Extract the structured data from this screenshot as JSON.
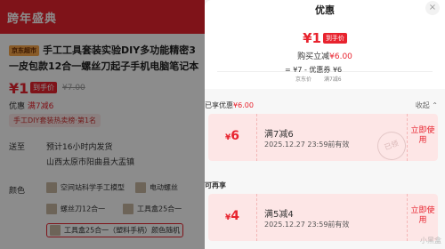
{
  "background": {
    "banner_title": "跨年盛典",
    "product_tag": "京东超市",
    "product_title_line1": "手工工具套装实验DIY多功能精密3",
    "product_title_line2": "一皮包款12合一螺丝刀起子手机电脑笔记本",
    "price_symbol": "¥",
    "price": "1",
    "price_badge": "到手价",
    "price_old": "¥7.00",
    "row_coupon_label": "优惠",
    "row_coupon_value": "满7减6",
    "rank_pill": "手工DIY套装热卖榜·第1名",
    "delivery_label": "送至",
    "delivery_text": "预计16小时内发货",
    "address_text": "山西太原市阳曲县大盂镇",
    "color_label": "颜色",
    "options": [
      "空间站科学手工模型",
      "电动螺丝",
      "螺丝刀12合一",
      "工具盒25合一",
      "工具盒25合一（塑料手柄）颜色随机"
    ]
  },
  "panel": {
    "title": "优惠",
    "close_icon": "×",
    "summary": {
      "price_symbol": "¥",
      "price": "1",
      "price_badge": "到手价",
      "purchase_prefix": "购买立减",
      "purchase_amount": "¥6.00",
      "calc_eq": "=",
      "calc_price": "¥7",
      "calc_op": "- 优惠券",
      "calc_coupon": "¥6",
      "calc_sub_price": "京东价",
      "calc_sub_coupon": "满7减6"
    },
    "enjoyed": {
      "label_prefix": "已享优惠",
      "amount": "¥6.00",
      "collapse": "收起",
      "coupon": {
        "amount_symbol": "¥",
        "amount": "6",
        "title": "满7减6",
        "date": "2025.12.27 23:59前有效",
        "use": "立即使用",
        "stamp": "已领"
      }
    },
    "more": {
      "label": "可再享",
      "coupon": {
        "amount_symbol": "¥",
        "amount": "4",
        "title": "满5减4",
        "date": "2025.12.27 23:59前有效",
        "use": "立即使用"
      }
    },
    "watermark": "小黑盒"
  }
}
